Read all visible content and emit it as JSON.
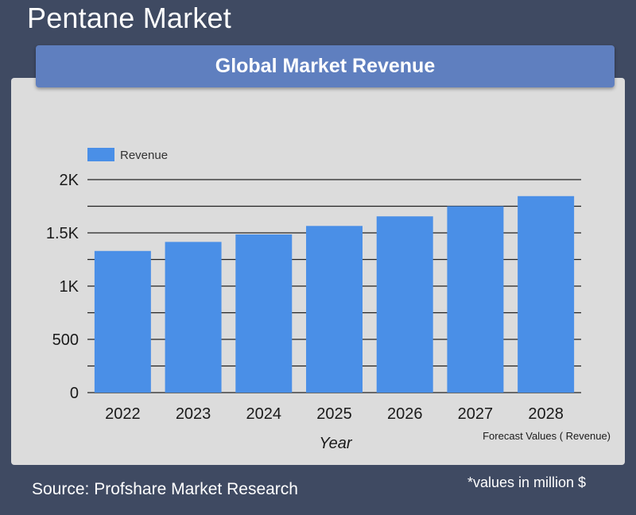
{
  "page_title": "Pentane Market",
  "header": "Global Market Revenue",
  "footer": {
    "source": "Source: Profshare Market Research",
    "note": "*values in million $"
  },
  "colors": {
    "bar": "#4a8fe7",
    "background": "#3f4a62",
    "panel": "#dcdcdc",
    "header_bar": "#5f7fbf"
  },
  "chart_data": {
    "type": "bar",
    "categories": [
      "2022",
      "2023",
      "2024",
      "2025",
      "2026",
      "2027",
      "2028"
    ],
    "series": [
      {
        "name": "Revenue",
        "values": [
          1330,
          1415,
          1485,
          1565,
          1655,
          1750,
          1845
        ]
      }
    ],
    "xlabel": "Year",
    "ylabel": "",
    "ylim": [
      0,
      2000
    ],
    "yticks": [
      0,
      500,
      1000,
      1500,
      2000
    ],
    "ytick_labels": [
      "0",
      "500",
      "1K",
      "1.5K",
      "2K"
    ],
    "grid": true,
    "legend": "top-left",
    "annotation": "Forecast Values ( Revenue)"
  }
}
